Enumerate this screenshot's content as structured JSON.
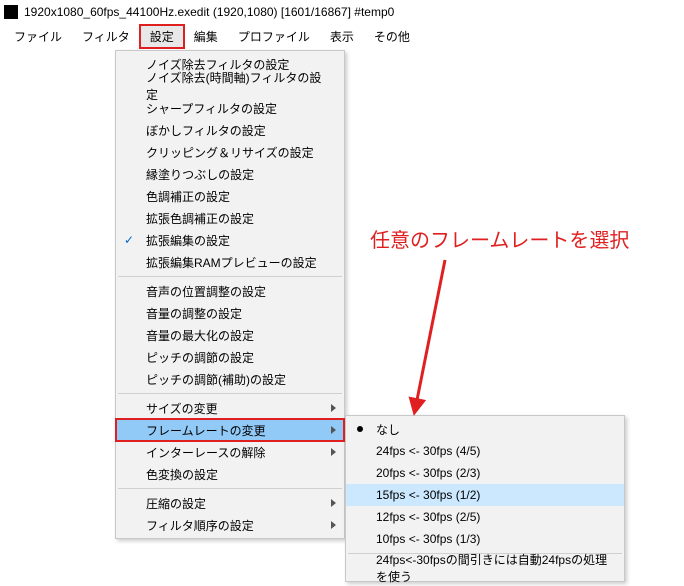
{
  "titlebar": {
    "text": "1920x1080_60fps_44100Hz.exedit (1920,1080) [1601/16867]  #temp0"
  },
  "menubar": {
    "items": [
      {
        "label": "ファイル"
      },
      {
        "label": "フィルタ"
      },
      {
        "label": "設定"
      },
      {
        "label": "編集"
      },
      {
        "label": "プロファイル"
      },
      {
        "label": "表示"
      },
      {
        "label": "その他"
      }
    ]
  },
  "dropdown": {
    "items": [
      {
        "label": "ノイズ除去フィルタの設定"
      },
      {
        "label": "ノイズ除去(時間軸)フィルタの設定"
      },
      {
        "label": "シャープフィルタの設定"
      },
      {
        "label": "ぼかしフィルタの設定"
      },
      {
        "label": "クリッピング＆リサイズの設定"
      },
      {
        "label": "縁塗りつぶしの設定"
      },
      {
        "label": "色調補正の設定"
      },
      {
        "label": "拡張色調補正の設定"
      },
      {
        "label": "拡張編集の設定"
      },
      {
        "label": "拡張編集RAMプレビューの設定"
      },
      {
        "label": "音声の位置調整の設定"
      },
      {
        "label": "音量の調整の設定"
      },
      {
        "label": "音量の最大化の設定"
      },
      {
        "label": "ピッチの調節の設定"
      },
      {
        "label": "ピッチの調節(補助)の設定"
      },
      {
        "label": "サイズの変更"
      },
      {
        "label": "フレームレートの変更"
      },
      {
        "label": "インターレースの解除"
      },
      {
        "label": "色変換の設定"
      },
      {
        "label": "圧縮の設定"
      },
      {
        "label": "フィルタ順序の設定"
      }
    ]
  },
  "submenu": {
    "items": [
      {
        "label": "なし"
      },
      {
        "label": "24fps <- 30fps (4/5)"
      },
      {
        "label": "20fps <- 30fps (2/3)"
      },
      {
        "label": "15fps <- 30fps (1/2)"
      },
      {
        "label": "12fps <- 30fps (2/5)"
      },
      {
        "label": "10fps <- 30fps (1/3)"
      },
      {
        "label": "24fps<-30fpsの間引きには自動24fpsの処理を使う"
      }
    ]
  },
  "annotation": {
    "text": "任意のフレームレートを選択"
  }
}
